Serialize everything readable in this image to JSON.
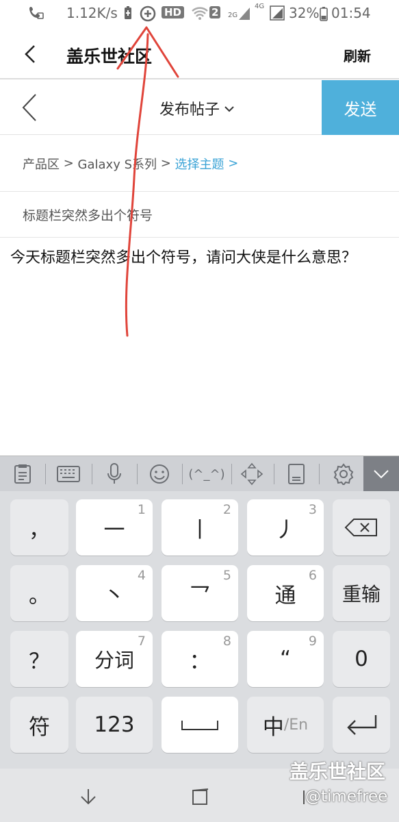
{
  "status_bar": {
    "net_speed": "1.12K/s",
    "hd_badge": "HD",
    "sim_badge": "2",
    "net_2g": "2G",
    "net_4g": "4G",
    "battery": "32%",
    "time": "01:54"
  },
  "app_bar": {
    "title": "盖乐世社区",
    "refresh_label": "刷新"
  },
  "compose_bar": {
    "title": "发布帖子",
    "send_label": "发送"
  },
  "breadcrumb": {
    "area": "产品区",
    "sep1": " > ",
    "series": "Galaxy S系列",
    "sep2": " > ",
    "topic_link": "选择主题",
    "chevron": " >"
  },
  "post": {
    "title": "标题栏突然多出个符号",
    "body": "今天标题栏突然多出个符号，请问大侠是什么意思？"
  },
  "keyboard_toolbar": {
    "emoticon_label": "(^_^)"
  },
  "keyboard": {
    "rows": [
      [
        {
          "label": "，",
          "num": ""
        },
        {
          "label": "一",
          "num": "1"
        },
        {
          "label": "丨",
          "num": "2"
        },
        {
          "label": "丿",
          "num": "3"
        },
        {
          "label": "",
          "num": ""
        }
      ],
      [
        {
          "label": "。",
          "num": ""
        },
        {
          "label": "丶",
          "num": "4"
        },
        {
          "label": "乛",
          "num": "5"
        },
        {
          "label": "通",
          "num": "6"
        },
        {
          "label": "重输",
          "num": ""
        }
      ],
      [
        {
          "label": "？",
          "num": ""
        },
        {
          "label": "分词",
          "num": "7"
        },
        {
          "label": "：",
          "num": "8"
        },
        {
          "label": "“",
          "num": "9"
        },
        {
          "label": "0",
          "num": ""
        }
      ],
      [
        {
          "label": "符",
          "num": ""
        },
        {
          "label": "123",
          "num": ""
        },
        {
          "label": "",
          "num": ""
        },
        {
          "label": "中",
          "num": ""
        },
        {
          "label": "",
          "num": ""
        }
      ]
    ],
    "lang_suffix": "/En"
  },
  "watermark": {
    "line1": "盖乐世社区",
    "line2": "@timefree"
  },
  "colors": {
    "accent": "#4fb0db",
    "annotation": "#e0443a"
  },
  "icons": [
    "phone-wifi-icon",
    "battery-saver-icon",
    "data-saver-icon",
    "wifi-icon",
    "signal-icon",
    "battery-icon",
    "back-icon",
    "chevron-down-icon",
    "clipboard-icon",
    "keyboard-icon",
    "mic-icon",
    "emoji-icon",
    "cursor-icon",
    "onehand-icon",
    "settings-icon",
    "backspace-icon",
    "space-icon",
    "enter-icon",
    "nav-back-icon",
    "nav-recent-icon"
  ]
}
